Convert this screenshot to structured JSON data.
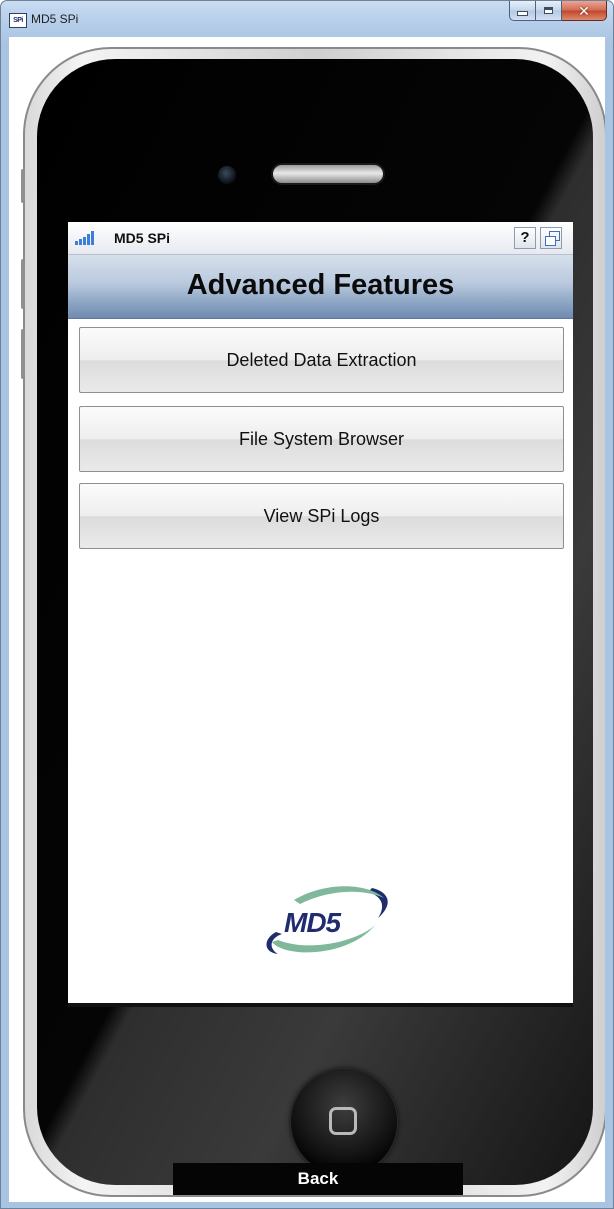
{
  "window": {
    "title": "MD5 SPi",
    "icon_text": "SPi"
  },
  "app": {
    "status_name": "MD5 SPi",
    "help_label": "?",
    "header_title": "Advanced Features",
    "buttons": [
      {
        "label": "Deleted Data Extraction"
      },
      {
        "label": "File System Browser"
      },
      {
        "label": "View SPi Logs"
      }
    ],
    "logo_text": "MD5",
    "back_label": "Back"
  },
  "colors": {
    "header_blue": "#8da6c4",
    "signal_blue": "#3d7fd6",
    "logo_navy": "#1f2d6e",
    "logo_green": "#7fb89a",
    "close_red": "#c2452a"
  }
}
